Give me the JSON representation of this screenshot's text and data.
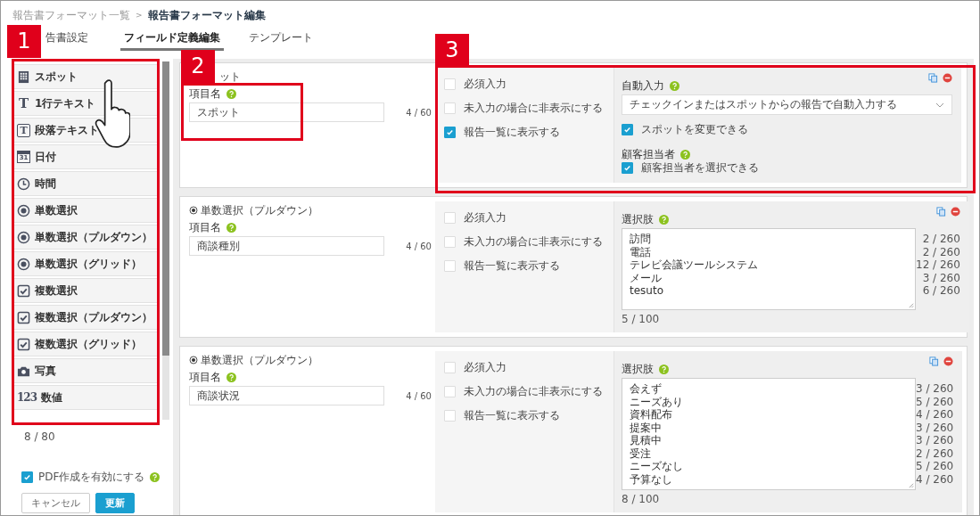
{
  "breadcrumb": {
    "parent": "報告書フォーマット一覧",
    "separator": ">",
    "current": "報告書フォーマット編集"
  },
  "tabs": [
    {
      "label": "告書設定",
      "selected": false
    },
    {
      "label": "フィールド定義編集",
      "selected": true
    },
    {
      "label": "テンプレート",
      "selected": false
    }
  ],
  "palette": [
    {
      "kind": "building",
      "label": "スポット"
    },
    {
      "kind": "text",
      "icon_text": "T",
      "label": "1行テキスト"
    },
    {
      "kind": "paragraph",
      "icon_text": "T",
      "label": "段落テキスト"
    },
    {
      "kind": "calendar",
      "icon_text": "31",
      "label": "日付"
    },
    {
      "kind": "clock",
      "label": "時間"
    },
    {
      "kind": "radio",
      "label": "単数選択"
    },
    {
      "kind": "radio",
      "label": "単数選択（プルダウン）"
    },
    {
      "kind": "radio",
      "label": "単数選択（グリッド）"
    },
    {
      "kind": "checkbox",
      "label": "複数選択"
    },
    {
      "kind": "checkbox",
      "label": "複数選択（プルダウン）"
    },
    {
      "kind": "checkbox",
      "label": "複数選択（グリッド）"
    },
    {
      "kind": "camera",
      "label": "写真"
    },
    {
      "kind": "number",
      "icon_text": "123",
      "label": "数値"
    }
  ],
  "field_count": "8 / 80",
  "pdf_option": {
    "label": "PDF作成を有効にする",
    "checked": true
  },
  "buttons": [
    {
      "kind": "secondary",
      "label": "キャンセル"
    },
    {
      "kind": "primary",
      "label": "更新"
    }
  ],
  "fields": [
    {
      "kind": "spot",
      "type_label": "ット",
      "name_label": "項目名",
      "name_value": "スポット",
      "name_count": "4 / 60",
      "options": [
        {
          "label": "必須入力",
          "checked": false
        },
        {
          "label": "未入力の場合に非表示にする",
          "checked": false
        },
        {
          "label": "報告一覧に表示する",
          "checked": true
        }
      ],
      "auto_input_label": "自動入力",
      "auto_input_value": "チェックインまたはスポットからの報告で自動入力する",
      "spot_change": {
        "label": "スポットを変更できる",
        "checked": true
      },
      "customer_label": "顧客担当者",
      "customer_select": {
        "label": "顧客担当者を選択できる",
        "checked": true
      }
    },
    {
      "kind": "choice",
      "type_label": "単数選択（プルダウン）",
      "name_label": "項目名",
      "name_value": "商談種別",
      "name_count": "4 / 60",
      "options": [
        {
          "label": "必須入力",
          "checked": false
        },
        {
          "label": "未入力の場合に非表示にする",
          "checked": false
        },
        {
          "label": "報告一覧に表示する",
          "checked": false
        }
      ],
      "choices_label": "選択肢",
      "choices_count": "5 / 100",
      "choices": [
        {
          "text": "訪問",
          "count": "2 / 260"
        },
        {
          "text": "電話",
          "count": "2 / 260"
        },
        {
          "text": "テレビ会議ツールシステム",
          "count": "12 / 260"
        },
        {
          "text": "メール",
          "count": "3 / 260"
        },
        {
          "text": "tesuto",
          "count": "6 / 260"
        }
      ]
    },
    {
      "kind": "choice",
      "type_label": "単数選択（プルダウン）",
      "name_label": "項目名",
      "name_value": "商談状況",
      "name_count": "4 / 60",
      "options": [
        {
          "label": "必須入力",
          "checked": false
        },
        {
          "label": "未入力の場合に非表示にする",
          "checked": false
        },
        {
          "label": "報告一覧に表示する",
          "checked": false
        }
      ],
      "choices_label": "選択肢",
      "choices_count": "8 / 100",
      "choices": [
        {
          "text": "会えず",
          "count": "3 / 260"
        },
        {
          "text": "ニーズあり",
          "count": "5 / 260"
        },
        {
          "text": "資料配布",
          "count": "4 / 260"
        },
        {
          "text": "提案中",
          "count": "3 / 260"
        },
        {
          "text": "見積中",
          "count": "3 / 260"
        },
        {
          "text": "受注",
          "count": "2 / 260"
        },
        {
          "text": "ニーズなし",
          "count": "5 / 260"
        },
        {
          "text": "予算なし",
          "count": "4 / 260"
        }
      ]
    }
  ],
  "callouts": [
    {
      "number": "1"
    },
    {
      "number": "2"
    },
    {
      "number": "3"
    }
  ]
}
